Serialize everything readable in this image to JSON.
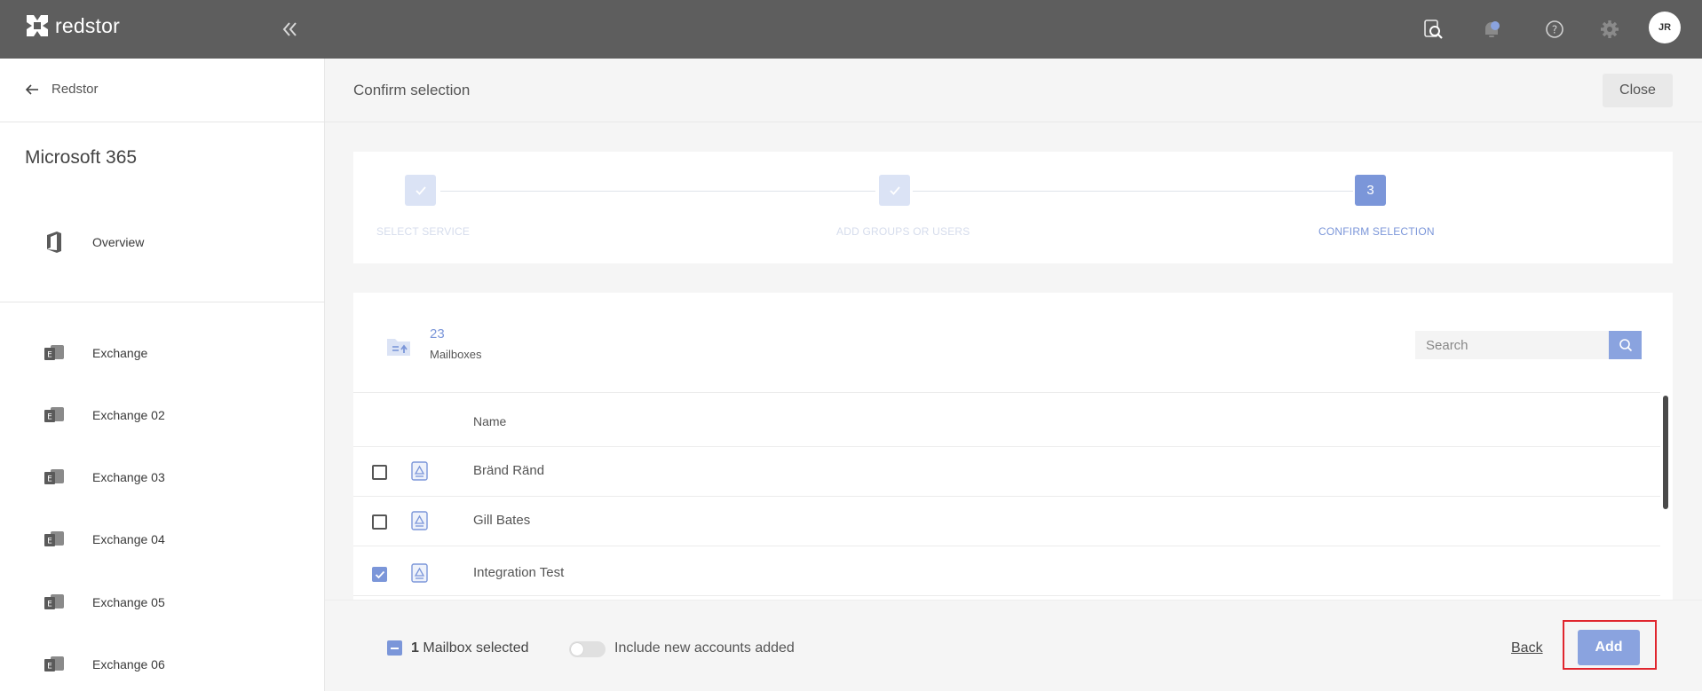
{
  "topbar": {
    "logo_text": "redstor",
    "collapse_icon": "chevrons-left-icon",
    "icons": [
      "search-document-icon",
      "notification-bell-icon",
      "help-icon",
      "settings-gear-icon"
    ],
    "avatar_initials": "JR"
  },
  "sidebar": {
    "back_label": "Redstor",
    "title": "Microsoft 365",
    "overview_label": "Overview",
    "items": [
      {
        "label": "Exchange"
      },
      {
        "label": "Exchange 02"
      },
      {
        "label": "Exchange 03"
      },
      {
        "label": "Exchange 04"
      },
      {
        "label": "Exchange 05"
      },
      {
        "label": "Exchange 06"
      }
    ]
  },
  "main": {
    "title": "Confirm selection",
    "close_label": "Close"
  },
  "stepper": {
    "steps": [
      {
        "label": "SELECT SERVICE",
        "state": "done"
      },
      {
        "label": "ADD GROUPS OR USERS",
        "state": "done"
      },
      {
        "label": "CONFIRM SELECTION",
        "state": "active",
        "number": "3"
      }
    ]
  },
  "panel": {
    "count": "23",
    "count_label": "Mailboxes",
    "search_placeholder": "Search",
    "column_name": "Name",
    "rows": [
      {
        "name": "Bränd Ränd",
        "checked": false
      },
      {
        "name": "Gill Bates",
        "checked": false
      },
      {
        "name": "Integration Test",
        "checked": true
      }
    ]
  },
  "footer": {
    "selected_count": "1",
    "selected_label": "Mailbox selected",
    "toggle_label": "Include new accounts added",
    "toggle_on": false,
    "back_label": "Back",
    "add_label": "Add"
  },
  "colors": {
    "accent": "#7b96d9",
    "topbar": "#5e5e5e",
    "highlight": "#e0262e"
  }
}
